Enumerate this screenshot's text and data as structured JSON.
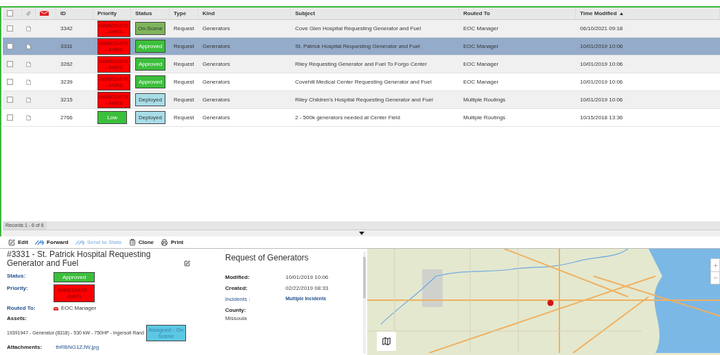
{
  "table": {
    "columns": [
      {
        "kind": "checkbox",
        "checked": false
      },
      {
        "kind": "attachment"
      },
      {
        "kind": "email"
      },
      {
        "kind": "text",
        "label": "ID"
      },
      {
        "kind": "text",
        "label": "Priority"
      },
      {
        "kind": "text",
        "label": "Status"
      },
      {
        "kind": "text",
        "label": "Type"
      },
      {
        "kind": "text",
        "label": "Kind"
      },
      {
        "kind": "text",
        "label": "Subject"
      },
      {
        "kind": "text",
        "label": "Routed To"
      },
      {
        "kind": "sorted",
        "label": "Time Modified"
      }
    ],
    "rows": [
      {
        "selected": false,
        "checked": false,
        "id": "3342",
        "priority": {
          "label": "IMMEDIATE - 4HRS",
          "color": "#ff0000"
        },
        "status": {
          "label": "On-Scene",
          "color": "#7fb55c"
        },
        "type": "Request",
        "kind": "Generators",
        "subject": "Cove Glen Hospital Requesting Generator and Fuel",
        "routed_to": "EOC Manager",
        "time_modified": "06/10/2021 09:18"
      },
      {
        "selected": true,
        "checked": false,
        "id": "3331",
        "priority": {
          "label": "IMMEDIATE - 4HRS",
          "color": "#ff0000"
        },
        "status": {
          "label": "Approved",
          "color": "#3cbf3c"
        },
        "type": "Request",
        "kind": "Generators",
        "subject": "St. Patrick Hospital Requesting Generator and Fuel",
        "routed_to": "EOC Manager",
        "time_modified": "10/01/2019 10:06"
      },
      {
        "selected": false,
        "checked": false,
        "id": "3262",
        "priority": {
          "label": "IMMEDIATE - 4HRS",
          "color": "#ff0000"
        },
        "status": {
          "label": "Approved",
          "color": "#3cbf3c"
        },
        "type": "Request",
        "kind": "Generators",
        "subject": "Riley Requesting Generator and Fuel To Forgo Center",
        "routed_to": "EOC Manager",
        "time_modified": "10/01/2019 10:06"
      },
      {
        "selected": false,
        "checked": false,
        "id": "3239",
        "priority": {
          "label": "IMMEDIATE - 4HRS",
          "color": "#ff0000"
        },
        "status": {
          "label": "Approved",
          "color": "#3cbf3c"
        },
        "type": "Request",
        "kind": "Generators",
        "subject": "Covehill Medical Center Requesting Generator and Fuel",
        "routed_to": "EOC Manager",
        "time_modified": "10/01/2019 10:06"
      },
      {
        "selected": false,
        "checked": false,
        "id": "3215",
        "priority": {
          "label": "IMMEDIATE - 4HRS",
          "color": "#ff0000"
        },
        "status": {
          "label": "Deployed",
          "color": "#a8dde8"
        },
        "type": "Request",
        "kind": "Generators",
        "subject": "Riley Children's Hospital Requesting Generator and Fuel",
        "routed_to": "Multiple Routings",
        "time_modified": "10/01/2019 10:06"
      },
      {
        "selected": false,
        "checked": false,
        "id": "2766",
        "priority": {
          "label": "Low",
          "color": "#3cbf3c"
        },
        "status": {
          "label": "Deployed",
          "color": "#a8dde8"
        },
        "type": "Request",
        "kind": "Generators",
        "subject": "2 - 500k generators needed at Center Field",
        "routed_to": "Multiple Routings",
        "time_modified": "10/15/2018 13:36"
      }
    ],
    "footer": "Records 1 - 6 of 6"
  },
  "toolbar": [
    {
      "kind": "edit",
      "label": "Edit",
      "disabled": false
    },
    {
      "kind": "forward",
      "label": "Forward",
      "disabled": false
    },
    {
      "kind": "forward",
      "label": "Send to State",
      "disabled": true
    },
    {
      "kind": "clone",
      "label": "Clone",
      "disabled": false
    },
    {
      "kind": "print",
      "label": "Print",
      "disabled": false
    }
  ],
  "detail": {
    "title": "#3331 - St. Patrick Hospital Requesting Generator and Fuel",
    "status_label": "Status:",
    "status": {
      "label": "Approved",
      "color": "#3cbf3c"
    },
    "priority_label": "Priority:",
    "priority": {
      "label": "IMMEDIATE - 4HRS",
      "color": "#ff0000"
    },
    "routed_label": "Routed To:",
    "routed_to": "EOC Manager",
    "assets_label": "Assets:",
    "asset": "19391947 - Generator (8318) - 530 kW - 750HP - Ingersoll Rand",
    "asset_status": {
      "label": "Assigned - On Scene",
      "color": "#5bc8e3"
    },
    "attachments_label": "Attachments:",
    "attachment": "thRBNG1ZJW.jpg",
    "heading": "Request of Generators",
    "fields": [
      {
        "label": "Modified:",
        "value": "10/01/2019 10:06",
        "kind": "plain"
      },
      {
        "label": "Created:",
        "value": "02/22/2019 08:33",
        "kind": "plain"
      },
      {
        "label": "Incidents :",
        "value": "Multiple Incidents",
        "kind": "link"
      }
    ],
    "county_label": "County:",
    "county": "Missoula"
  }
}
